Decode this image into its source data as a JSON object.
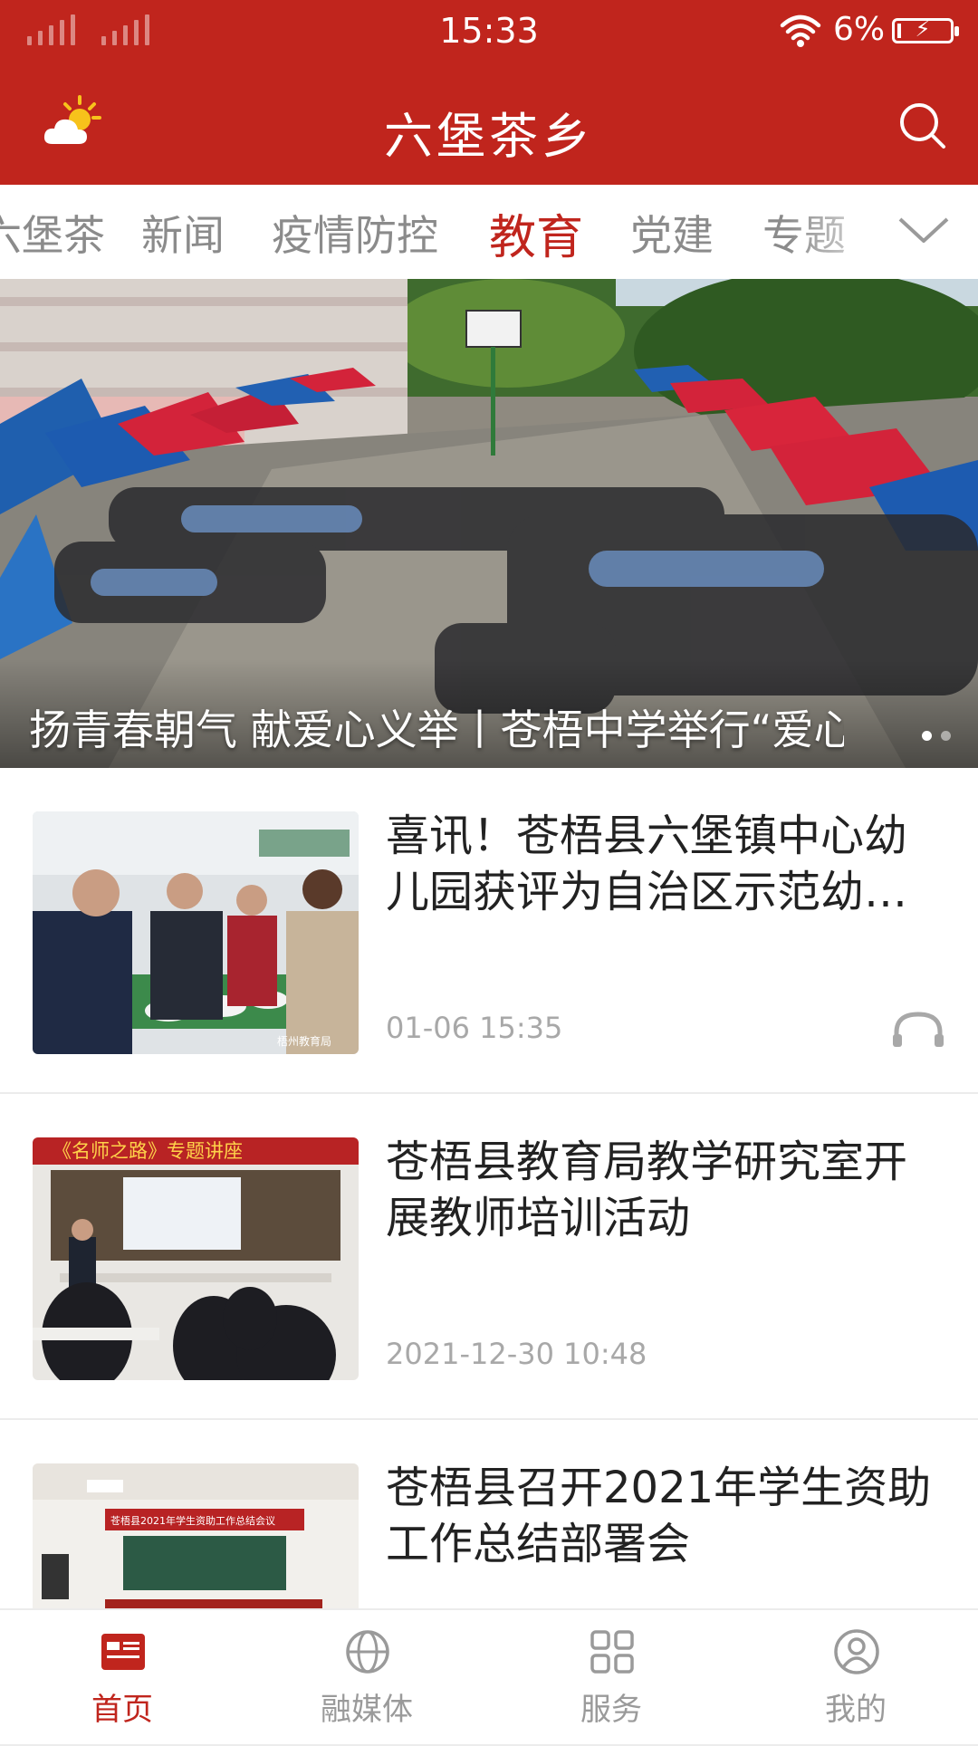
{
  "status_bar": {
    "time": "15:33",
    "battery": "6%",
    "icons": [
      "signal-icon",
      "signal-icon",
      "wifi-icon",
      "battery-charging-icon"
    ]
  },
  "header": {
    "title": "六堡茶乡",
    "left_icon": "weather-icon",
    "right_icon": "search-icon"
  },
  "tabs": [
    {
      "label": "六堡茶"
    },
    {
      "label": "新闻"
    },
    {
      "label": "疫情防控"
    },
    {
      "label": "教育",
      "active": true
    },
    {
      "label": "党建"
    },
    {
      "label": "专题"
    }
  ],
  "banner": {
    "title": "扬青春朝气 献爱心义举丨苍梧中学举行“爱心义卖”活动",
    "page_count": 2,
    "active_page": 1
  },
  "news": [
    {
      "title": "喜讯！苍梧县六堡镇中心幼儿园获评为自治区示范幼儿园",
      "time": "01-06 15:35",
      "has_audio": true,
      "thumb_watermark": "梧州教育局"
    },
    {
      "title": "苍梧县教育局教学研究室开展教师培训活动",
      "time": "2021-12-30 10:48",
      "thumb_caption": "《名师之路》专题讲座"
    },
    {
      "title": "苍梧县召开2021年学生资助工作总结部署会",
      "time": "",
      "thumb_caption": "苍梧县2021年学生资助工作总结会议"
    }
  ],
  "bottom_nav": [
    {
      "label": "首页",
      "icon": "newspaper-icon",
      "active": true
    },
    {
      "label": "融媒体",
      "icon": "globe-icon"
    },
    {
      "label": "服务",
      "icon": "grid-icon"
    },
    {
      "label": "我的",
      "icon": "user-icon"
    }
  ],
  "colors": {
    "brand": "#c0251d",
    "muted": "#8b8b8b"
  }
}
